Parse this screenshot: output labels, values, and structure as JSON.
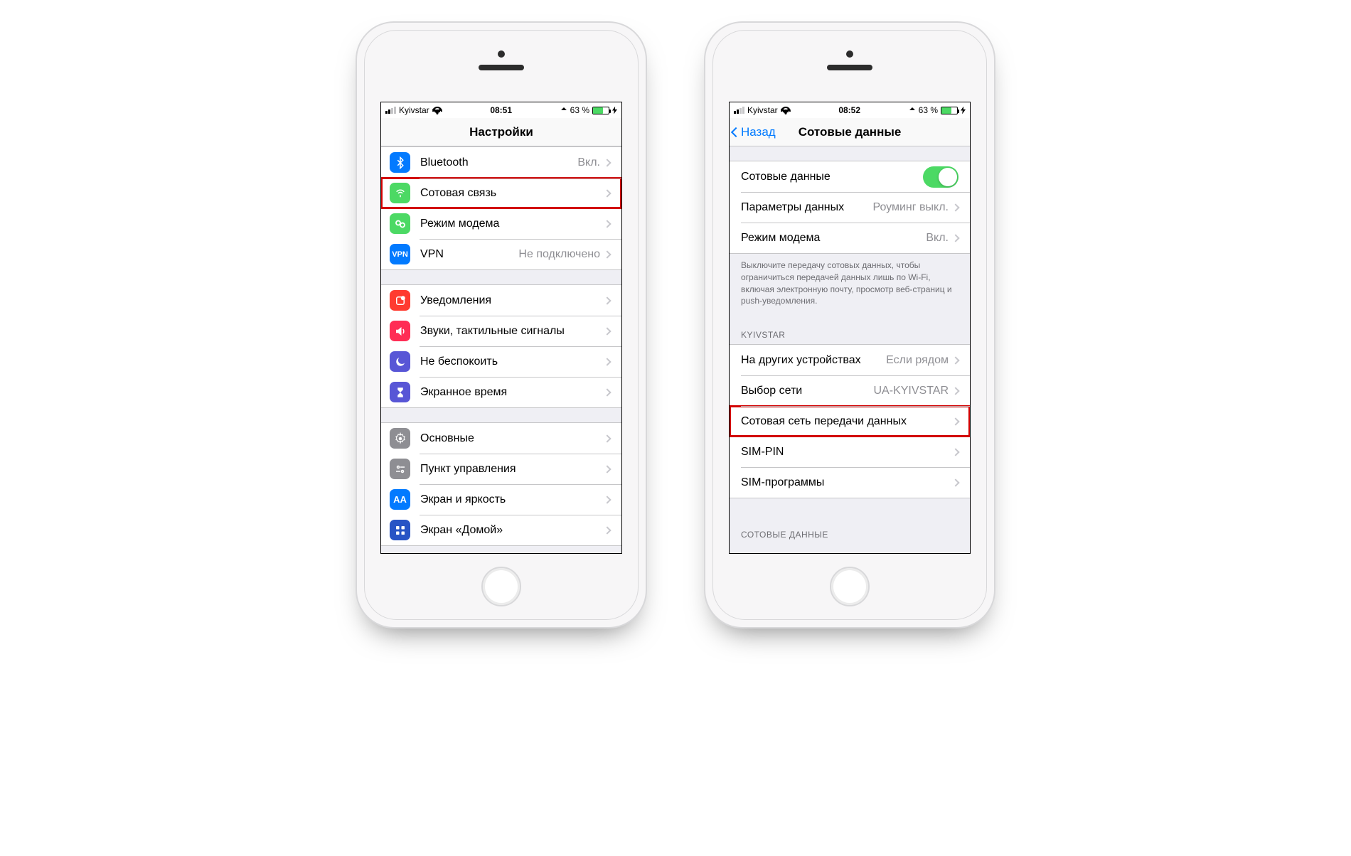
{
  "left_phone": {
    "status": {
      "carrier": "Kyivstar",
      "time": "08:51",
      "battery_pct": "63 %"
    },
    "nav_title": "Настройки",
    "g1": [
      {
        "label": "Bluetooth",
        "detail": "Вкл.",
        "icon_color": "#027aff",
        "icon": "bluetooth"
      },
      {
        "label": "Сотовая связь",
        "detail": "",
        "icon_color": "#4cd964",
        "icon": "cellular",
        "highlight": true
      },
      {
        "label": "Режим модема",
        "detail": "",
        "icon_color": "#4cd964",
        "icon": "hotspot"
      },
      {
        "label": "VPN",
        "detail": "Не подключено",
        "icon_color": "#027aff",
        "icon": "vpn"
      }
    ],
    "g2": [
      {
        "label": "Уведомления",
        "icon_color": "#ff3b30",
        "icon": "notify"
      },
      {
        "label": "Звуки, тактильные сигналы",
        "icon_color": "#ff2d55",
        "icon": "sounds"
      },
      {
        "label": "Не беспокоить",
        "icon_color": "#5856d6",
        "icon": "dnd"
      },
      {
        "label": "Экранное время",
        "icon_color": "#5856d6",
        "icon": "hourglass"
      }
    ],
    "g3": [
      {
        "label": "Основные",
        "icon_color": "#8e8e93",
        "icon": "gear"
      },
      {
        "label": "Пункт управления",
        "icon_color": "#8e8e93",
        "icon": "control"
      },
      {
        "label": "Экран и яркость",
        "icon_color": "#027aff",
        "icon": "bright"
      },
      {
        "label": "Экран «Домой»",
        "icon_color": "#2854c5",
        "icon": "home"
      }
    ]
  },
  "right_phone": {
    "status": {
      "carrier": "Kyivstar",
      "time": "08:52",
      "battery_pct": "63 %"
    },
    "nav_back": "Назад",
    "nav_title": "Сотовые данные",
    "g1": [
      {
        "label": "Сотовые данные",
        "type": "toggle",
        "on": true
      },
      {
        "label": "Параметры данных",
        "detail": "Роуминг выкл."
      },
      {
        "label": "Режим модема",
        "detail": "Вкл."
      }
    ],
    "g1_footer": "Выключите передачу сотовых данных, чтобы ограничиться передачей данных лишь по Wi-Fi, включая электронную почту, просмотр веб-страниц и push-уведомления.",
    "g2_header": "KYIVSTAR",
    "g2": [
      {
        "label": "На других устройствах",
        "detail": "Если рядом"
      },
      {
        "label": "Выбор сети",
        "detail": "UA-KYIVSTAR"
      },
      {
        "label": "Сотовая сеть передачи данных",
        "highlight": true
      },
      {
        "label": "SIM-PIN"
      },
      {
        "label": "SIM-программы"
      }
    ],
    "g3_header": "СОТОВЫЕ ДАННЫЕ"
  }
}
